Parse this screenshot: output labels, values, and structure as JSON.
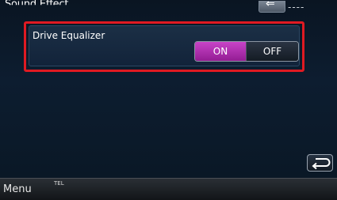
{
  "header": {
    "title": "Sound Effect",
    "back_icon": "back-arrow-icon",
    "status_text": "----"
  },
  "setting": {
    "label": "Drive Equalizer",
    "on_label": "ON",
    "off_label": "OFF",
    "selected": "ON",
    "accent_color": "#b030b0"
  },
  "controls": {
    "return_icon": "return-arrow-icon"
  },
  "bottom_bar": {
    "menu_label": "Menu",
    "tel_label": "TEL"
  }
}
